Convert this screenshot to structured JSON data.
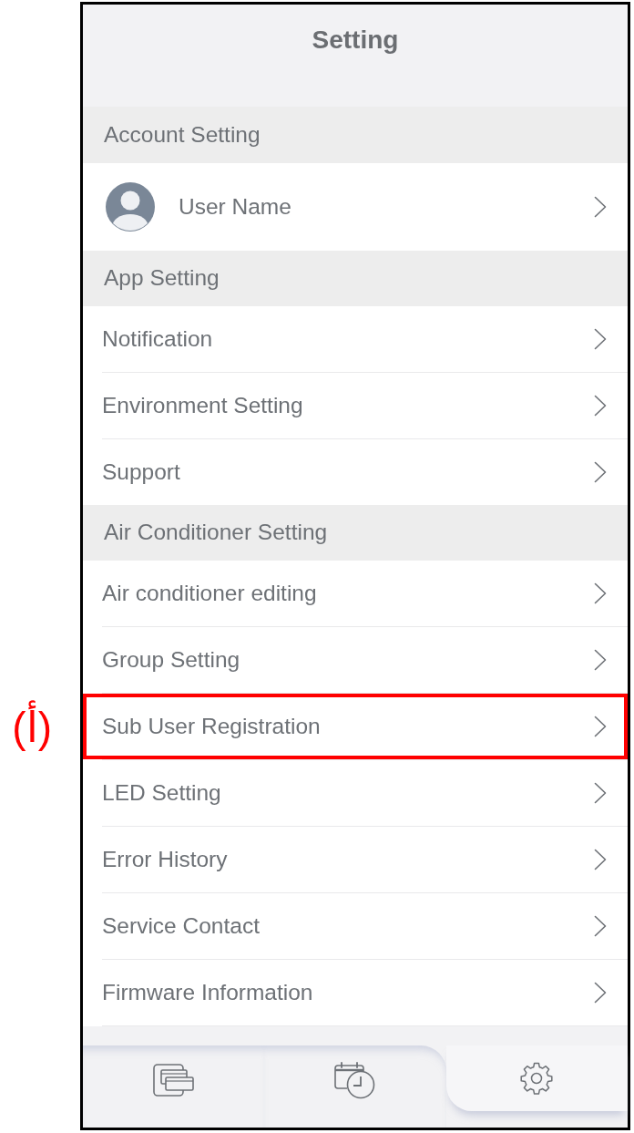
{
  "header": {
    "title": "Setting"
  },
  "sections": [
    {
      "title": "Account Setting",
      "items": [
        {
          "kind": "account",
          "label": "User Name",
          "highlighted": false
        }
      ]
    },
    {
      "title": "App Setting",
      "items": [
        {
          "kind": "link",
          "label": "Notification",
          "highlighted": false
        },
        {
          "kind": "link",
          "label": "Environment Setting",
          "highlighted": false
        },
        {
          "kind": "link",
          "label": "Support",
          "highlighted": false
        }
      ]
    },
    {
      "title": "Air Conditioner Setting",
      "items": [
        {
          "kind": "link",
          "label": "Air conditioner editing",
          "highlighted": false
        },
        {
          "kind": "link",
          "label": "Group Setting",
          "highlighted": false
        },
        {
          "kind": "link",
          "label": "Sub User Registration",
          "highlighted": true
        },
        {
          "kind": "link",
          "label": "LED Setting",
          "highlighted": false
        },
        {
          "kind": "link",
          "label": "Error History",
          "highlighted": false
        },
        {
          "kind": "link",
          "label": "Service Contact",
          "highlighted": false
        },
        {
          "kind": "link",
          "label": "Firmware Information",
          "highlighted": false
        }
      ]
    }
  ],
  "annotation": {
    "label": "(أ)"
  },
  "tab_bar": {
    "tabs": [
      {
        "kind": "devices",
        "selected": false
      },
      {
        "kind": "schedule",
        "selected": false
      },
      {
        "kind": "settings",
        "selected": true
      }
    ]
  }
}
